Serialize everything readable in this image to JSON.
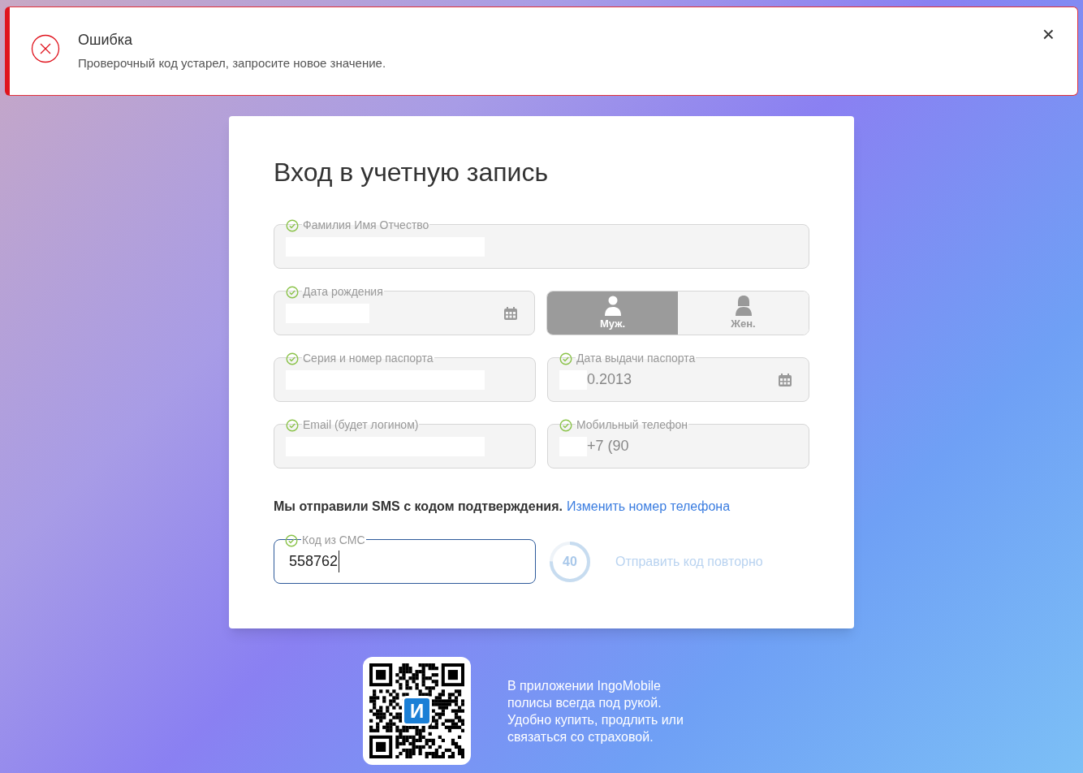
{
  "alert": {
    "kind": "error",
    "title": "Ошибка",
    "message": "Проверочный код устарел, запросите новое значение.",
    "close": "×"
  },
  "form": {
    "title": "Вход в учетную запись",
    "rows": [
      [
        {
          "kind": "text",
          "label": "Фамилия Имя Отчество",
          "valid": true,
          "redacted": true
        }
      ],
      [
        {
          "kind": "date",
          "label": "Дата рождения",
          "valid": true,
          "redacted": true
        },
        {
          "kind": "gender",
          "options": [
            {
              "label": "Муж.",
              "selected": true
            },
            {
              "label": "Жен.",
              "selected": false
            }
          ]
        }
      ],
      [
        {
          "kind": "text",
          "label": "Серия и номер паспорта",
          "valid": true,
          "redacted": true
        },
        {
          "kind": "date",
          "label": "Дата выдачи паспорта",
          "valid": true,
          "value": "0.2013",
          "redacted": true
        }
      ],
      [
        {
          "kind": "text",
          "label": "Email (будет логином)",
          "valid": true,
          "redacted": true
        },
        {
          "kind": "text",
          "label": "Мобильный телефон",
          "valid": true,
          "value": "+7 (90",
          "redacted": true
        }
      ]
    ],
    "sms_notice": "Мы отправили SMS с кодом подтверждения.",
    "change_phone_link": "Изменить номер телефона",
    "code_field": {
      "label": "Код из СМС",
      "valid": true,
      "value": "558762",
      "focused": true
    },
    "timer": {
      "reading": "40",
      "level": 0.75
    },
    "resend_link": "Отправить код повторно"
  },
  "promo": {
    "qr_logo": "И",
    "text": "В приложении IngoMobile полисы всегда под рукой. Удобно купить, продлить или связаться со страховой."
  }
}
